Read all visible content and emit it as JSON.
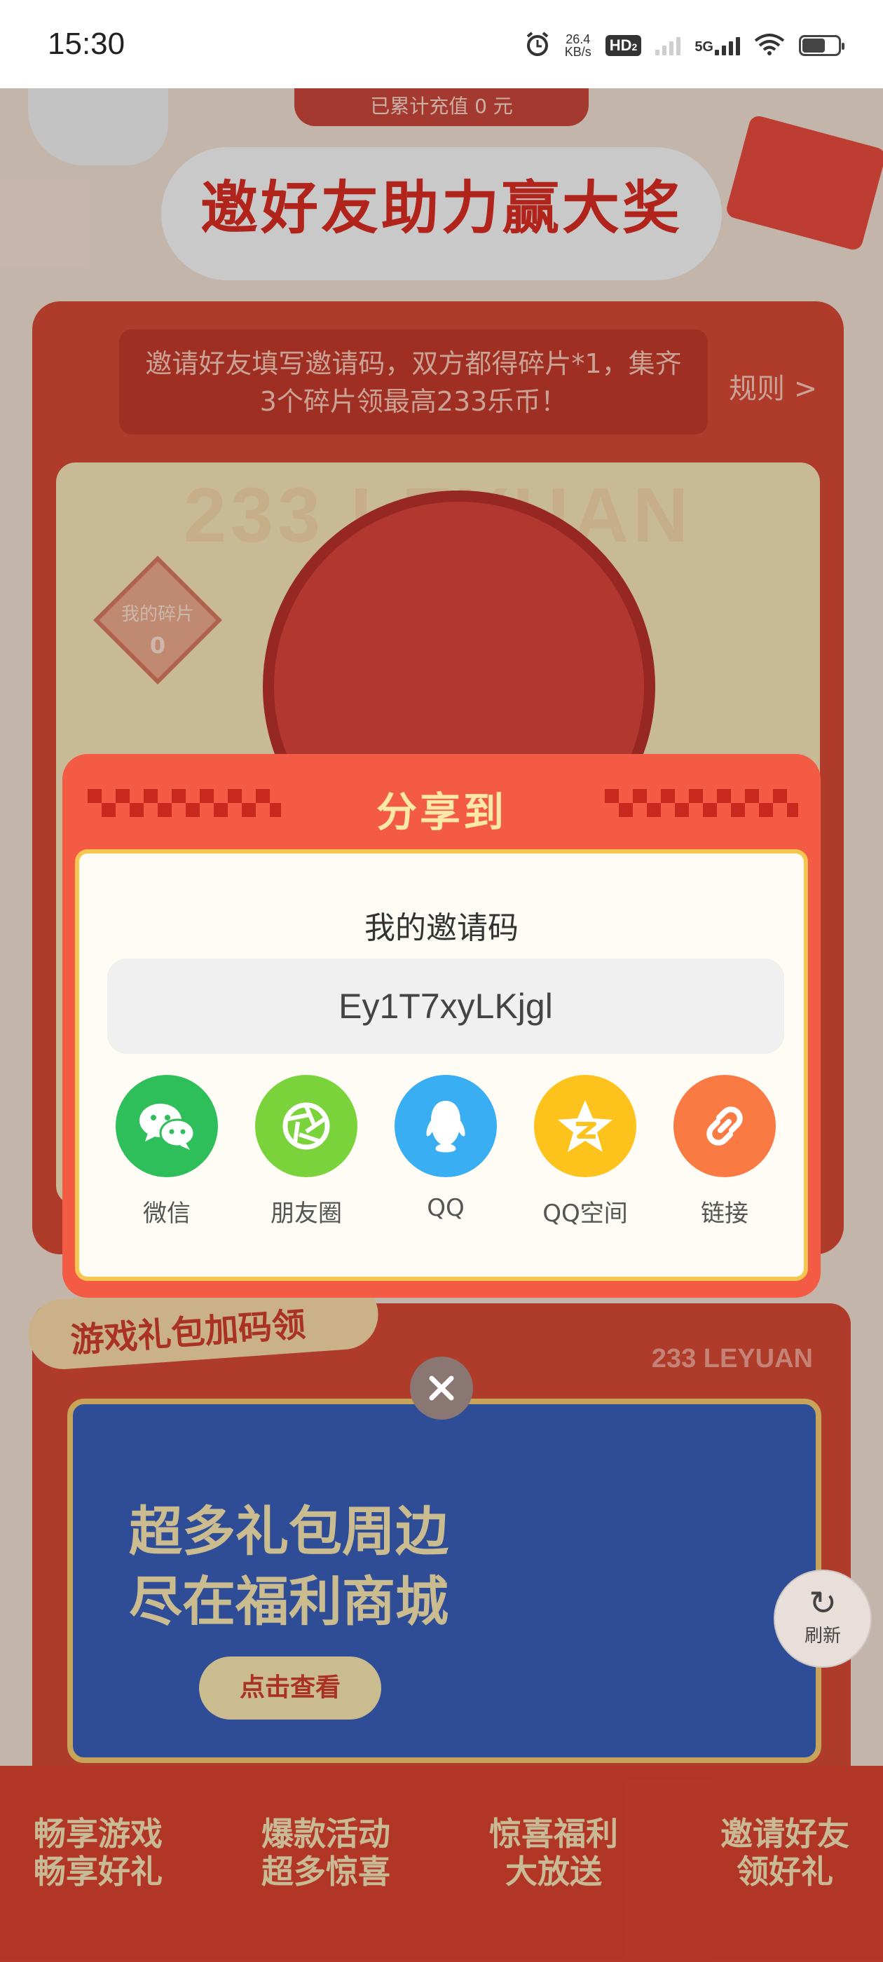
{
  "status_bar": {
    "time": "15:30",
    "net_speed_value": "26.4",
    "net_speed_unit": "KB/s",
    "hd_label": "HD",
    "hd_sub": "2",
    "network": "5G"
  },
  "background": {
    "top_banner_text": "已累计充值 0 元",
    "invite_title": "邀好友助力赢大奖",
    "rule_text": "邀请好友填写邀请码，双方都得碎片*1，集齐3个碎片领最高233乐币！",
    "rule_link": "规则 >",
    "wheel_watermark": "233 LEYUAN",
    "my_fragments_label": "我的碎片",
    "my_fragments_count": "0",
    "gift_ribbon": "游戏礼包加码领",
    "leyuan_label": "233 LEYUAN",
    "promo_line1": "超多礼包周边",
    "promo_line2": "尽在福利商城",
    "promo_cta": "点击查看",
    "refresh_label": "刷新",
    "bottom_nav": [
      {
        "line1": "畅享游戏",
        "line2": "畅享好礼"
      },
      {
        "line1": "爆款活动",
        "line2": "超多惊喜"
      },
      {
        "line1": "惊喜福利",
        "line2": "大放送"
      },
      {
        "line1": "邀请好友",
        "line2": "领好礼"
      }
    ]
  },
  "dialog": {
    "title": "分享到",
    "invite_label": "我的邀请码",
    "invite_code": "Ey1T7xyLKjgl",
    "share_targets": [
      {
        "label": "微信",
        "icon": "wechat-icon",
        "color": "#2fbf5a"
      },
      {
        "label": "朋友圈",
        "icon": "moments-icon",
        "color": "#7ad33a"
      },
      {
        "label": "QQ",
        "icon": "qq-icon",
        "color": "#3aaef3"
      },
      {
        "label": "QQ空间",
        "icon": "qzone-icon",
        "color": "#fdc31c"
      },
      {
        "label": "链接",
        "icon": "link-icon",
        "color": "#fa7a43"
      }
    ]
  },
  "colors": {
    "dialog_red": "#f45b45",
    "dialog_border": "#f6c64f",
    "title_gold": "#fde7a9"
  }
}
